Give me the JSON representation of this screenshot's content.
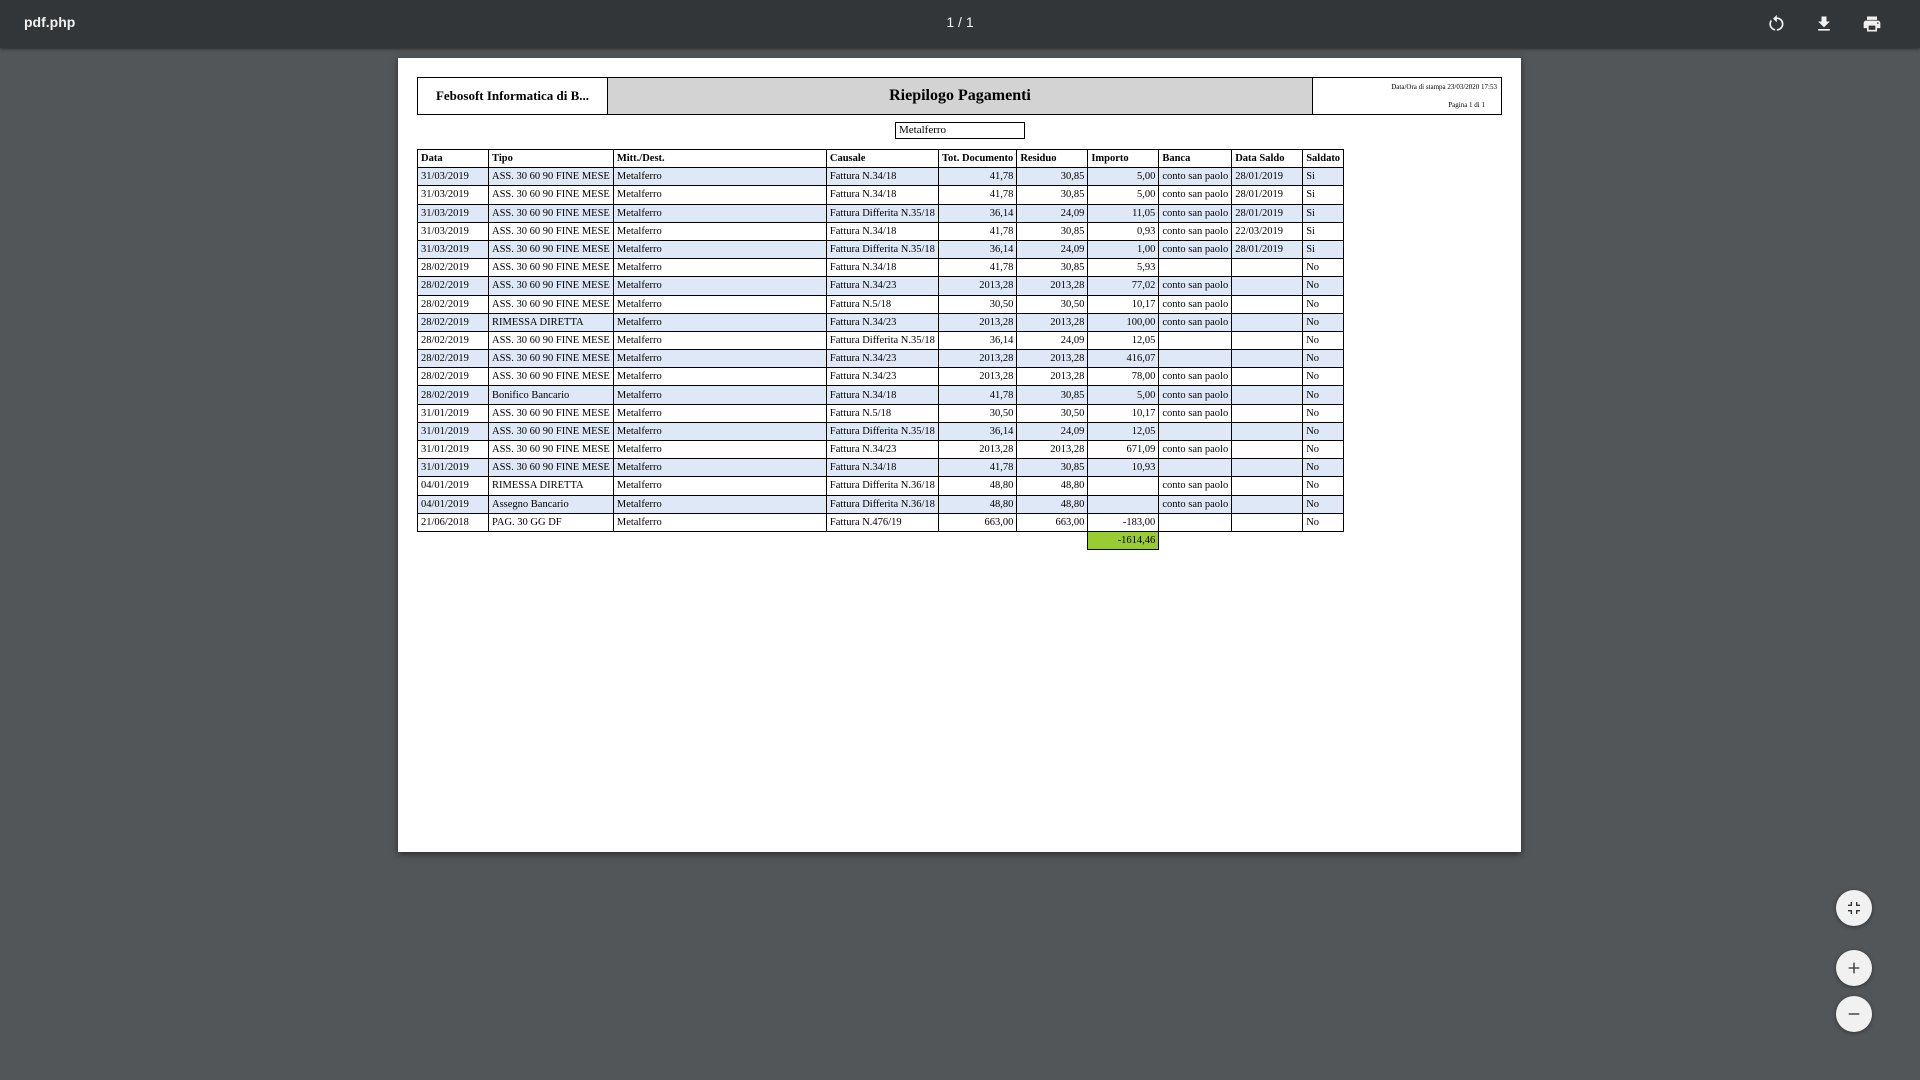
{
  "toolbar": {
    "title": "pdf.php",
    "page_indicator": "1 / 1",
    "rotate_icon": "rotate-icon",
    "download_icon": "download-icon",
    "print_icon": "print-icon"
  },
  "doc": {
    "company": "Febosoft Informatica di B...",
    "title": "Riepilogo Pagamenti",
    "print_datetime": "Data/Ora di stampa 23/03/2020 17:53",
    "page_info": "Pagina 1 di 1",
    "filter": "Metalferro",
    "columns": [
      "Data",
      "Tipo",
      "Mitt./Dest.",
      "Causale",
      "Tot. Documento",
      "Residuo",
      "Importo",
      "Banca",
      "Data Saldo",
      "Saldato"
    ],
    "rows": [
      [
        "31/03/2019",
        "ASS. 30 60 90 FINE MESE",
        "Metalferro",
        "Fattura N.34/18",
        "41,78",
        "30,85",
        "5,00",
        "conto san paolo",
        "28/01/2019",
        "Si"
      ],
      [
        "31/03/2019",
        "ASS. 30 60 90 FINE MESE",
        "Metalferro",
        "Fattura N.34/18",
        "41,78",
        "30,85",
        "5,00",
        "conto san paolo",
        "28/01/2019",
        "Si"
      ],
      [
        "31/03/2019",
        "ASS. 30 60 90 FINE MESE",
        "Metalferro",
        "Fattura Differita N.35/18",
        "36,14",
        "24,09",
        "11,05",
        "conto san paolo",
        "28/01/2019",
        "Si"
      ],
      [
        "31/03/2019",
        "ASS. 30 60 90 FINE MESE",
        "Metalferro",
        "Fattura N.34/18",
        "41,78",
        "30,85",
        "0,93",
        "conto san paolo",
        "22/03/2019",
        "Si"
      ],
      [
        "31/03/2019",
        "ASS. 30 60 90 FINE MESE",
        "Metalferro",
        "Fattura Differita N.35/18",
        "36,14",
        "24,09",
        "1,00",
        "conto san paolo",
        "28/01/2019",
        "Si"
      ],
      [
        "28/02/2019",
        "ASS. 30 60 90 FINE MESE",
        "Metalferro",
        "Fattura N.34/18",
        "41,78",
        "30,85",
        "5,93",
        "",
        "",
        "No"
      ],
      [
        "28/02/2019",
        "ASS. 30 60 90 FINE MESE",
        "Metalferro",
        "Fattura N.34/23",
        "2013,28",
        "2013,28",
        "77,02",
        "conto san paolo",
        "",
        "No"
      ],
      [
        "28/02/2019",
        "ASS. 30 60 90 FINE MESE",
        "Metalferro",
        "Fattura N.5/18",
        "30,50",
        "30,50",
        "10,17",
        "conto san paolo",
        "",
        "No"
      ],
      [
        "28/02/2019",
        "RIMESSA DIRETTA",
        "Metalferro",
        "Fattura N.34/23",
        "2013,28",
        "2013,28",
        "100,00",
        "conto san paolo",
        "",
        "No"
      ],
      [
        "28/02/2019",
        "ASS. 30 60 90 FINE MESE",
        "Metalferro",
        "Fattura Differita N.35/18",
        "36,14",
        "24,09",
        "12,05",
        "",
        "",
        "No"
      ],
      [
        "28/02/2019",
        "ASS. 30 60 90 FINE MESE",
        "Metalferro",
        "Fattura N.34/23",
        "2013,28",
        "2013,28",
        "416,07",
        "",
        "",
        "No"
      ],
      [
        "28/02/2019",
        "ASS. 30 60 90 FINE MESE",
        "Metalferro",
        "Fattura N.34/23",
        "2013,28",
        "2013,28",
        "78,00",
        "conto san paolo",
        "",
        "No"
      ],
      [
        "28/02/2019",
        "Bonifico Bancario",
        "Metalferro",
        "Fattura N.34/18",
        "41,78",
        "30,85",
        "5,00",
        "conto san paolo",
        "",
        "No"
      ],
      [
        "31/01/2019",
        "ASS. 30 60 90 FINE MESE",
        "Metalferro",
        "Fattura N.5/18",
        "30,50",
        "30,50",
        "10,17",
        "conto san paolo",
        "",
        "No"
      ],
      [
        "31/01/2019",
        "ASS. 30 60 90 FINE MESE",
        "Metalferro",
        "Fattura Differita N.35/18",
        "36,14",
        "24,09",
        "12,05",
        "",
        "",
        "No"
      ],
      [
        "31/01/2019",
        "ASS. 30 60 90 FINE MESE",
        "Metalferro",
        "Fattura N.34/23",
        "2013,28",
        "2013,28",
        "671,09",
        "conto san paolo",
        "",
        "No"
      ],
      [
        "31/01/2019",
        "ASS. 30 60 90 FINE MESE",
        "Metalferro",
        "Fattura N.34/18",
        "41,78",
        "30,85",
        "10,93",
        "",
        "",
        "No"
      ],
      [
        "04/01/2019",
        "RIMESSA DIRETTA",
        "Metalferro",
        "Fattura Differita N.36/18",
        "48,80",
        "48,80",
        "",
        "conto san paolo",
        "",
        "No"
      ],
      [
        "04/01/2019",
        "Assegno Bancario",
        "Metalferro",
        "Fattura Differita N.36/18",
        "48,80",
        "48,80",
        "",
        "conto san paolo",
        "",
        "No"
      ],
      [
        "21/06/2018",
        "PAG. 30 GG DF",
        "Metalferro",
        "Fattura N.476/19",
        "663,00",
        "663,00",
        "-183,00",
        "",
        "",
        "No"
      ]
    ],
    "total": "-1614,46",
    "total_color": "#99cc33"
  },
  "controls": {
    "fit_icon": "fit-page-icon",
    "zoom_in_icon": "zoom-in-icon",
    "zoom_out_icon": "zoom-out-icon"
  },
  "colors": {
    "toolbar_bg": "#323639",
    "viewer_bg": "#525659",
    "row_alt": "#dfe8f6",
    "title_bg": "#d3d3d3"
  }
}
